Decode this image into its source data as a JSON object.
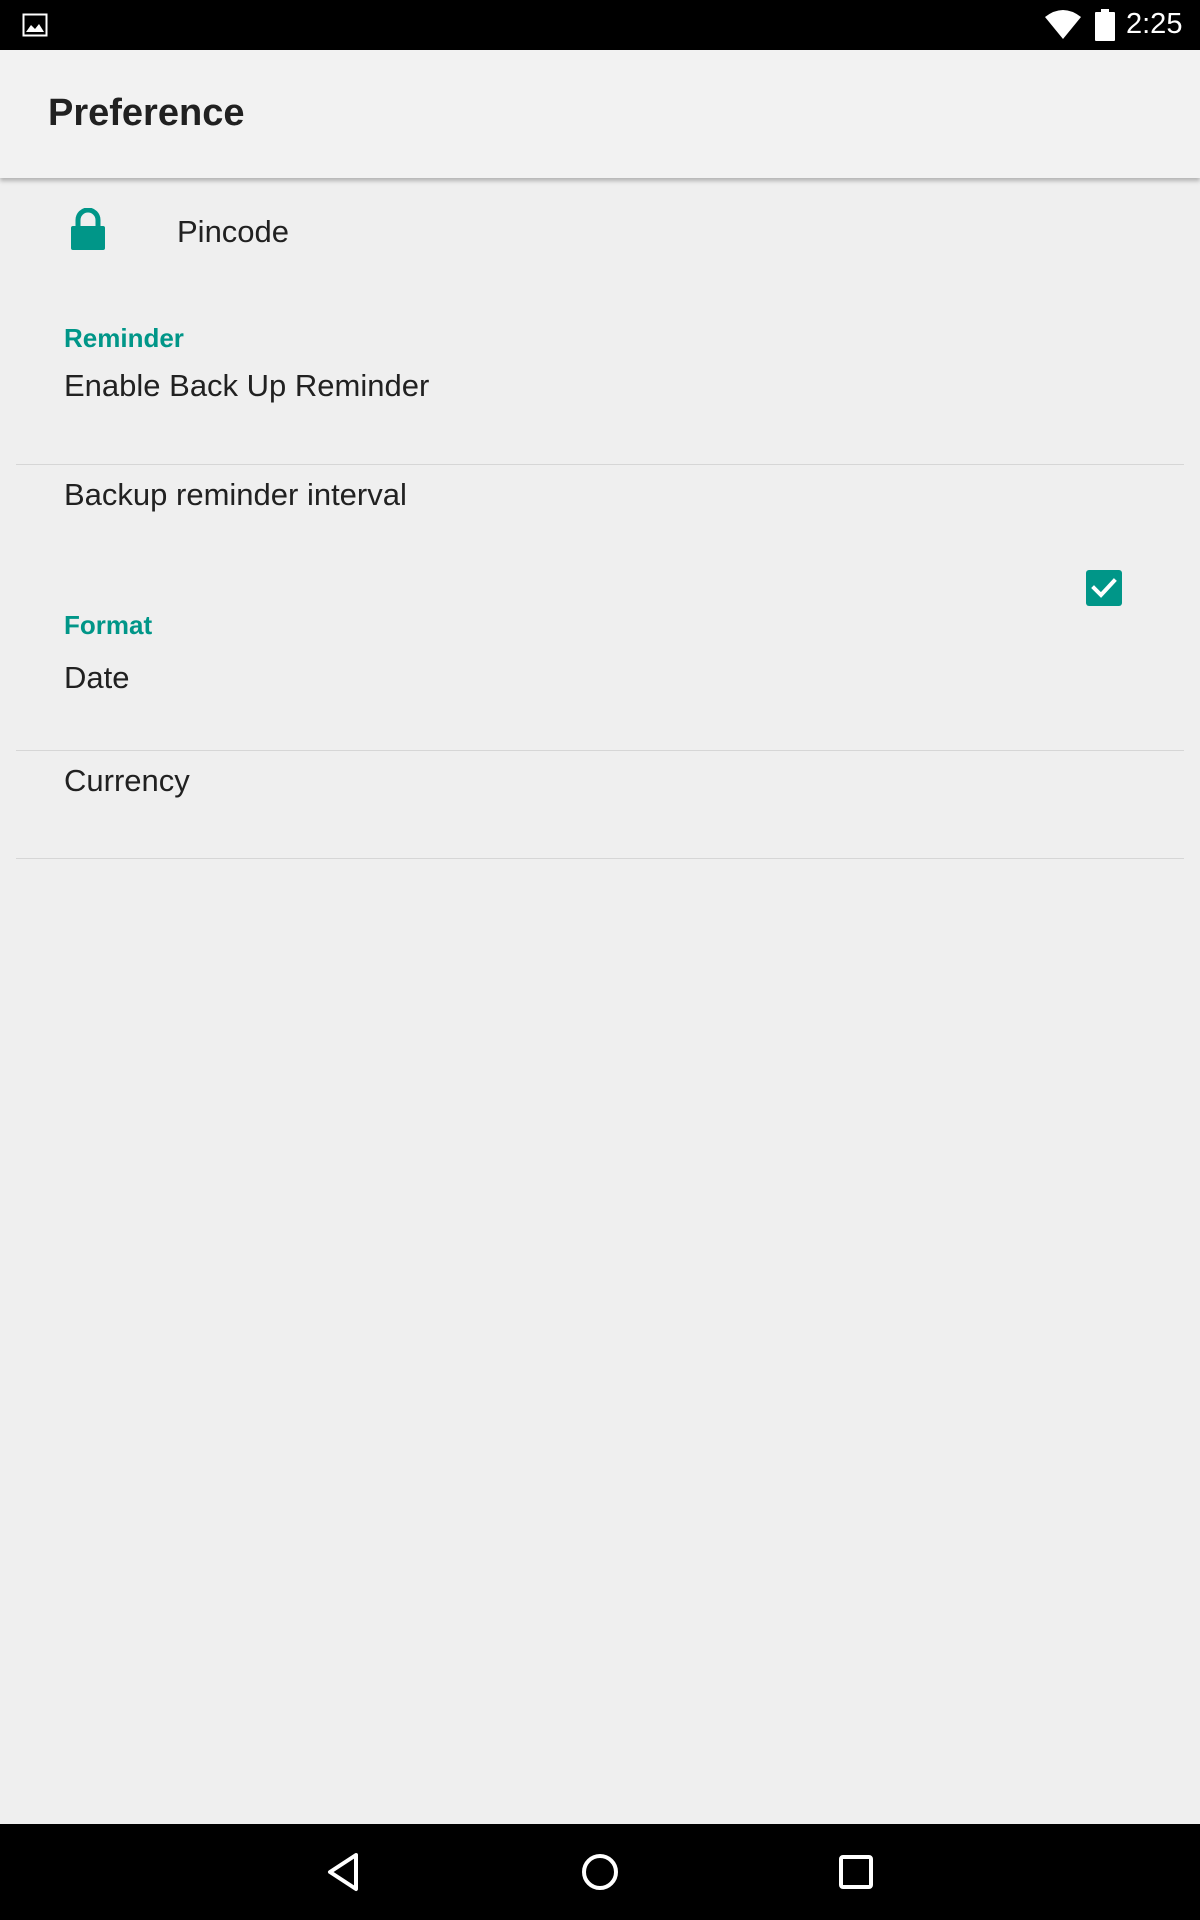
{
  "status_bar": {
    "time": "2:25",
    "icons": [
      "gallery-icon",
      "wifi-icon",
      "battery-icon"
    ]
  },
  "app_bar": {
    "title": "Preference"
  },
  "preferences": {
    "pincode": {
      "label": "Pincode",
      "icon": "lock-icon"
    },
    "reminder_section": {
      "header": "Reminder",
      "enable_backup_reminder": {
        "label": "Enable Back Up Reminder",
        "checked": true
      },
      "backup_reminder_interval": {
        "label": "Backup reminder interval"
      }
    },
    "format_section": {
      "header": "Format",
      "date": {
        "label": "Date"
      },
      "currency": {
        "label": "Currency"
      }
    }
  },
  "nav_bar": {
    "icons": [
      "back-icon",
      "home-icon",
      "recents-icon"
    ]
  },
  "colors": {
    "accent": "#009688",
    "background": "#efefef",
    "app_bar": "#f2f2f2",
    "text_primary": "#212121"
  }
}
